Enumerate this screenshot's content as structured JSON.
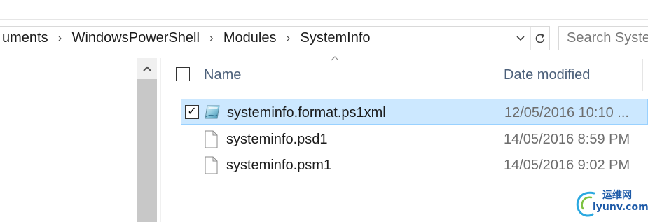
{
  "address_bar": {
    "crumbs": [
      "uments",
      "WindowsPowerShell",
      "Modules",
      "SystemInfo"
    ],
    "separator": "›"
  },
  "search": {
    "placeholder": "Search Syste"
  },
  "columns": {
    "name": "Name",
    "date_modified": "Date modified"
  },
  "files": [
    {
      "name": "systeminfo.format.ps1xml",
      "date": "12/05/2016 10:10 ...",
      "icon": "xml-document-icon",
      "selected": true,
      "checked": true
    },
    {
      "name": "systeminfo.psd1",
      "date": "14/05/2016 8:59 PM",
      "icon": "blank-file-icon",
      "selected": false,
      "checked": false
    },
    {
      "name": "systeminfo.psm1",
      "date": "14/05/2016 9:02 PM",
      "icon": "blank-file-icon",
      "selected": false,
      "checked": false
    }
  ],
  "watermark": {
    "cn": "运维网",
    "en": "iyunv.com"
  },
  "colors": {
    "selection": "#cce8ff",
    "selection_border": "#99d1ff",
    "header_text": "#4c607a",
    "accent": "#1d5aa8"
  }
}
